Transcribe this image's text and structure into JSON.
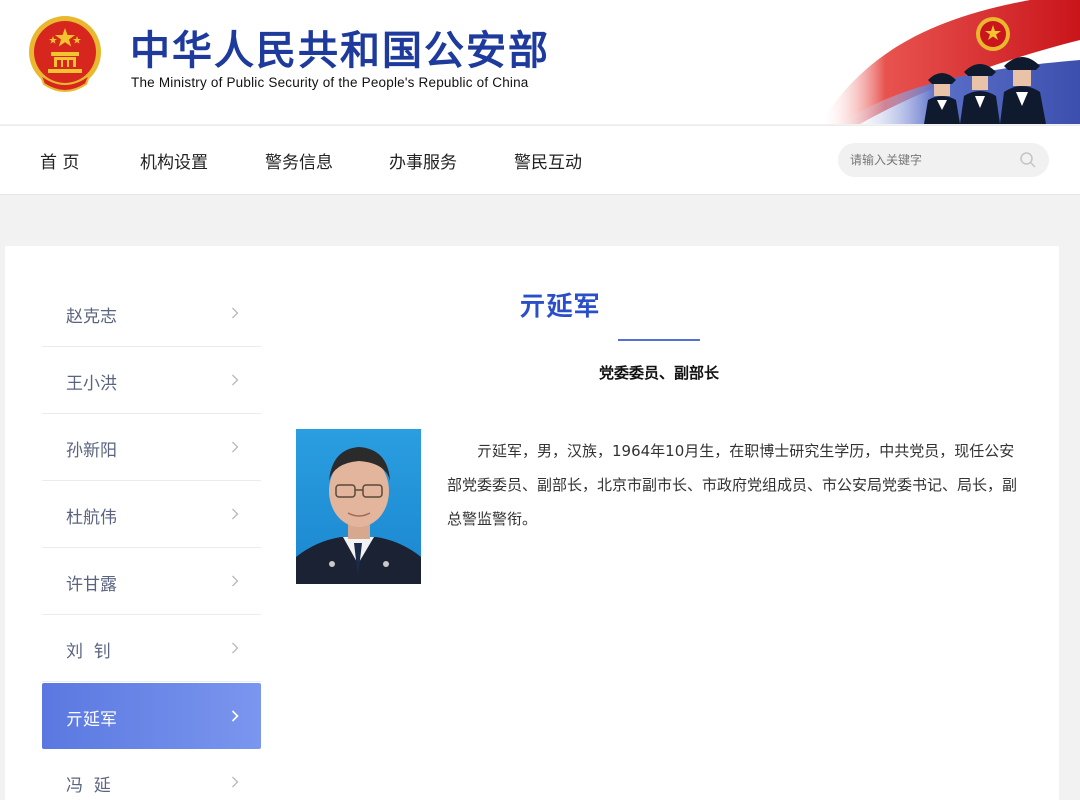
{
  "header": {
    "title_cn": "中华人民共和国公安部",
    "title_en": "The Ministry of Public Security of the People's Republic of China",
    "emblem_icon": "national-emblem-icon",
    "banner_icon": "flag-police-banner"
  },
  "nav": {
    "items": [
      "首 页",
      "机构设置",
      "警务信息",
      "办事服务",
      "警民互动"
    ],
    "search_placeholder": "请输入关键字",
    "search_icon": "search-icon"
  },
  "sidebar": {
    "items": [
      {
        "label": "赵克志",
        "active": false
      },
      {
        "label": "王小洪",
        "active": false
      },
      {
        "label": "孙新阳",
        "active": false
      },
      {
        "label": "杜航伟",
        "active": false
      },
      {
        "label": "许甘露",
        "active": false
      },
      {
        "label": "刘  钊",
        "active": false
      },
      {
        "label": "亓延军",
        "active": true
      },
      {
        "label": "冯  延",
        "active": false
      }
    ]
  },
  "profile": {
    "name": "亓延军",
    "role": "党委委员、副部长",
    "bio": "亓延军，男，汉族，1964年10月生，在职博士研究生学历，中共党员，现任公安部党委委员、副部长，北京市副市长、市政府党组成员、市公安局党委书记、局长，副总警监警衔。"
  },
  "colors": {
    "brand_blue": "#1d3a9c",
    "accent_blue": "#2a4fc9",
    "active_gradient_start": "#5a78e0",
    "active_gradient_end": "#7b96ef"
  }
}
